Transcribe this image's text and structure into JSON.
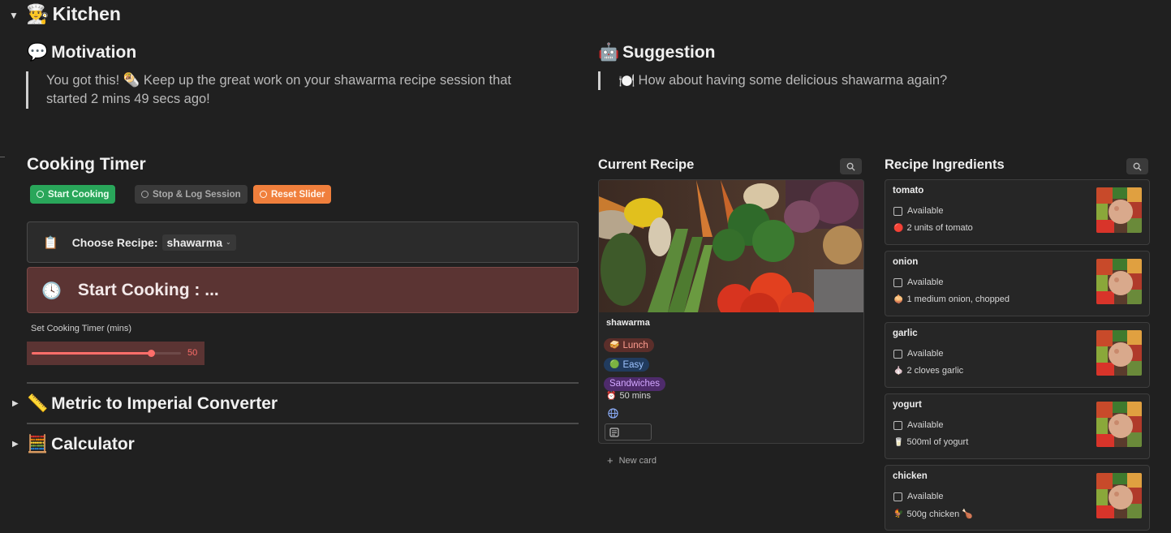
{
  "header": {
    "toggle": "▼",
    "icon": "👨‍🍳",
    "title": "Kitchen"
  },
  "motivation": {
    "icon": "💬",
    "title": "Motivation",
    "text_line1": "You got this! 🌯 Keep up the great work on your shawarma recipe session that",
    "text_line2": "started 2 mins 49 secs ago!"
  },
  "suggestion": {
    "icon": "🤖",
    "title": "Suggestion",
    "icon2": "🍽️",
    "text": "How about having some delicious shawarma again?"
  },
  "timer": {
    "title": "Cooking Timer",
    "buttons": {
      "start": "Start Cooking",
      "stop": "Stop & Log Session",
      "reset": "Reset Slider"
    },
    "choose_icon": "📋",
    "choose_label": "Choose Recipe:",
    "choose_value": "shawarma",
    "start_icon": "🕓",
    "start_text": "Start Cooking : ...",
    "slider_label": "Set Cooking Timer (mins)",
    "slider_value": "50",
    "slider_fraction": 0.8
  },
  "collapsibles": [
    {
      "toggle": "▶",
      "icon": "📏",
      "title": "Metric to Imperial Converter"
    },
    {
      "toggle": "▶",
      "icon": "🧮",
      "title": "Calculator"
    }
  ],
  "current_recipe": {
    "title": "Current Recipe",
    "card": {
      "name": "shawarma",
      "tags": [
        {
          "icon": "🥪",
          "label": "Lunch",
          "bg": "#5b2e2a",
          "color": "#ff9c8f"
        },
        {
          "icon": "🟢",
          "label": "Easy",
          "bg": "#213b5e",
          "color": "#9ec4ff"
        },
        {
          "icon": "",
          "label": "Sandwiches",
          "bg": "#4e2b6b",
          "color": "#d2a7ff"
        }
      ],
      "time_icon": "⏰",
      "time": "50 mins"
    },
    "new_card": "New card"
  },
  "ingredients": {
    "title": "Recipe Ingredients",
    "items": [
      {
        "name": "tomato",
        "available": "Available",
        "icon": "🔴",
        "qty": "2 units of tomato"
      },
      {
        "name": "onion",
        "available": "Available",
        "icon": "🧅",
        "qty": "1 medium onion, chopped"
      },
      {
        "name": "garlic",
        "available": "Available",
        "icon": "🧄",
        "qty": "2 cloves garlic"
      },
      {
        "name": "yogurt",
        "available": "Available",
        "icon": "🥛",
        "qty": "500ml of yogurt"
      },
      {
        "name": "chicken",
        "available": "Available",
        "icon": "🐓",
        "qty": "500g chicken 🍗"
      }
    ]
  }
}
